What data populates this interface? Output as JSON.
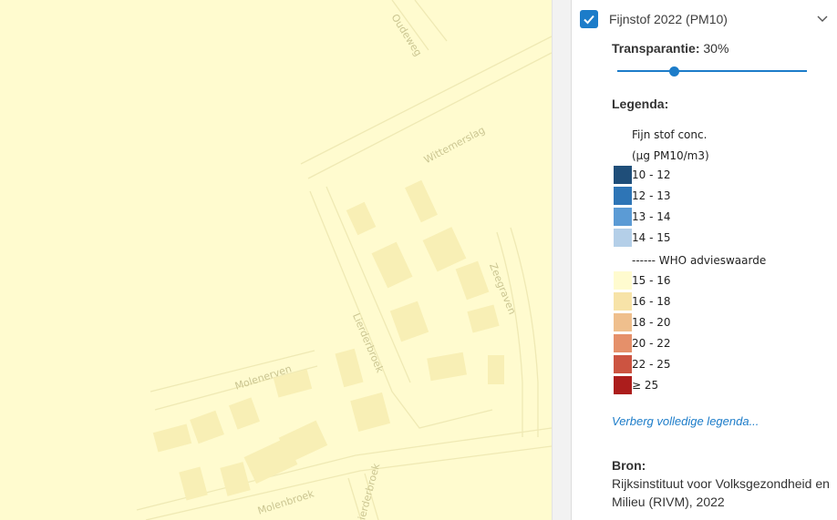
{
  "map": {
    "streets": [
      "Oudeweg",
      "Wittemerslag",
      "Zeegraven",
      "Lierderbroek",
      "Molenerven",
      "Molenbroek",
      "Lierderbroek"
    ],
    "background_color": "#fffbcf"
  },
  "layer": {
    "checked": true,
    "title": "Fijnstof 2022 (PM10)",
    "checkbox_color": "#1c7cc9"
  },
  "transparency": {
    "label": "Transparantie:",
    "value_text": "30%",
    "value_fraction": 0.3
  },
  "legend": {
    "heading": "Legenda:",
    "title_line1": "Fijn stof conc.",
    "title_line2": "(µg PM10/m3)",
    "items_low": [
      {
        "label": "10 - 12",
        "color": "#1f4e79"
      },
      {
        "label": "12 - 13",
        "color": "#2e75b6"
      },
      {
        "label": "13 - 14",
        "color": "#5b9bd5"
      },
      {
        "label": "14 - 15",
        "color": "#b4cfe8"
      }
    ],
    "who_line": "------ WHO advieswaarde",
    "items_high": [
      {
        "label": "15 - 16",
        "color": "#fffbcf"
      },
      {
        "label": "16 - 18",
        "color": "#f7e3a8"
      },
      {
        "label": "18 - 20",
        "color": "#efbf8d"
      },
      {
        "label": "20 - 22",
        "color": "#e5906a"
      },
      {
        "label": "22 - 25",
        "color": "#cc5441"
      },
      {
        "label": "≥ 25",
        "color": "#ac1d1c"
      }
    ],
    "toggle_link": "Verberg volledige legenda..."
  },
  "source": {
    "heading": "Bron:",
    "text": "Rijksinstituut voor Volksgezondheid en Milieu (RIVM), 2022"
  }
}
